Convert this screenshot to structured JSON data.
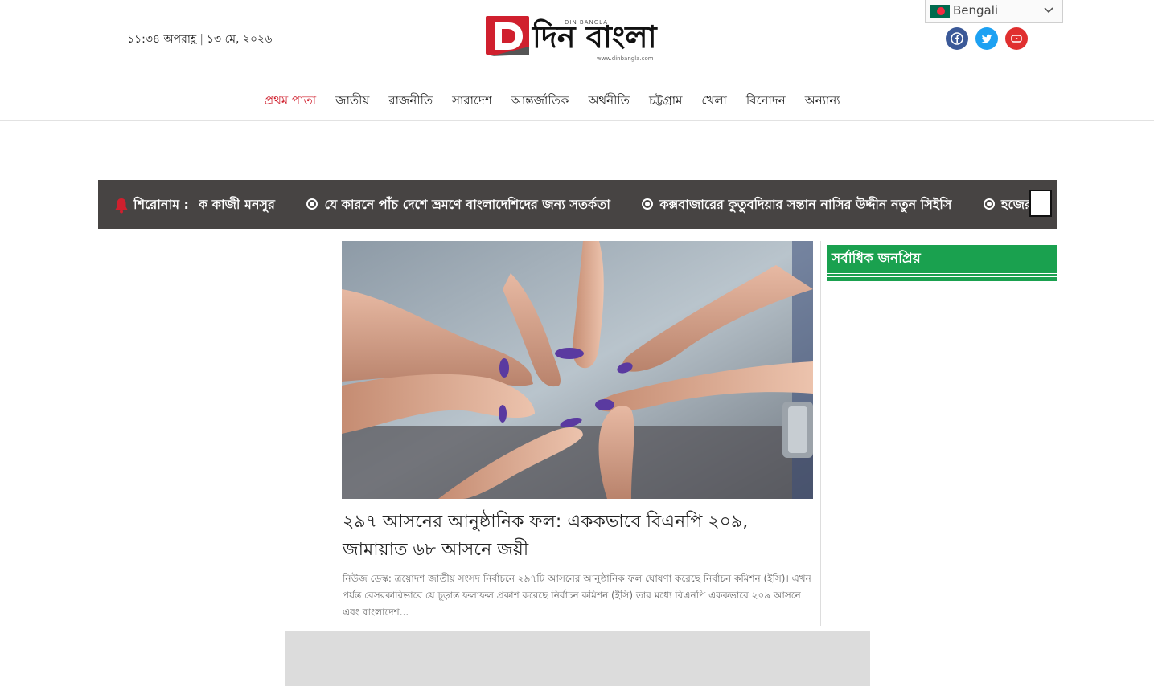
{
  "header": {
    "time": "১১:৩৪ অপরাহ্ণ",
    "date": "১৩ মে, ২০২৬",
    "separator": "|",
    "logo": {
      "small_text": "DIN BANGLA",
      "big_text": "দিন বাংলা",
      "url_text": "www.dinbangla.com",
      "brand_color": "#d0202e"
    },
    "language": {
      "selected": "Bengali"
    },
    "social": [
      "facebook-icon",
      "twitter-icon",
      "youtube-icon"
    ]
  },
  "nav": {
    "items": [
      {
        "label": "প্রথম পাতা",
        "active": true
      },
      {
        "label": "জাতীয়"
      },
      {
        "label": "রাজনীতি"
      },
      {
        "label": "সারাদেশ"
      },
      {
        "label": "আন্তর্জাতিক"
      },
      {
        "label": "অর্থনীতি"
      },
      {
        "label": "চট্টগ্রাম"
      },
      {
        "label": "খেলা"
      },
      {
        "label": "বিনোদন"
      },
      {
        "label": "অন্যান্য"
      }
    ]
  },
  "ticker": {
    "label": "শিরোনাম :",
    "lead_fragment": "ক কাজী মনসুর",
    "items": [
      "যে কারনে পাঁচ দেশে ভ্রমণে বাংলাদেশিদের জন্য সতর্কতা",
      "কক্সবাজারের কুতুবদিয়ার সন্তান নাসির উদ্দীন নতুন সিইসি",
      "হজের প্র"
    ]
  },
  "lead_story": {
    "headline": "২৯৭ আসনের আনুষ্ঠানিক ফল: এককভাবে বিএনপি ২০৯, জামায়াত ৬৮ আসনে জয়ী",
    "excerpt": "নিউজ ডেস্ক: ত্রয়োদশ জাতীয় সংসদ নির্বাচনে ২৯৭টি আসনের আনুষ্ঠানিক ফল ঘোষণা করেছে নির্বাচন কমিশন (ইসি)। এখন পর্যন্ত বেসরকারিভাবে যে চূড়ান্ত ফলাফল প্রকাশ করেছে নির্বাচন কমিশন (ইসি) তার মধ্যে বিএনপি এককভাবে ২০৯ আসনে এবং বাংলাদেশ..."
  },
  "sidebar": {
    "popular_title": "সর্বাধিক জনপ্রিয়",
    "accent": "#1aa14f"
  }
}
